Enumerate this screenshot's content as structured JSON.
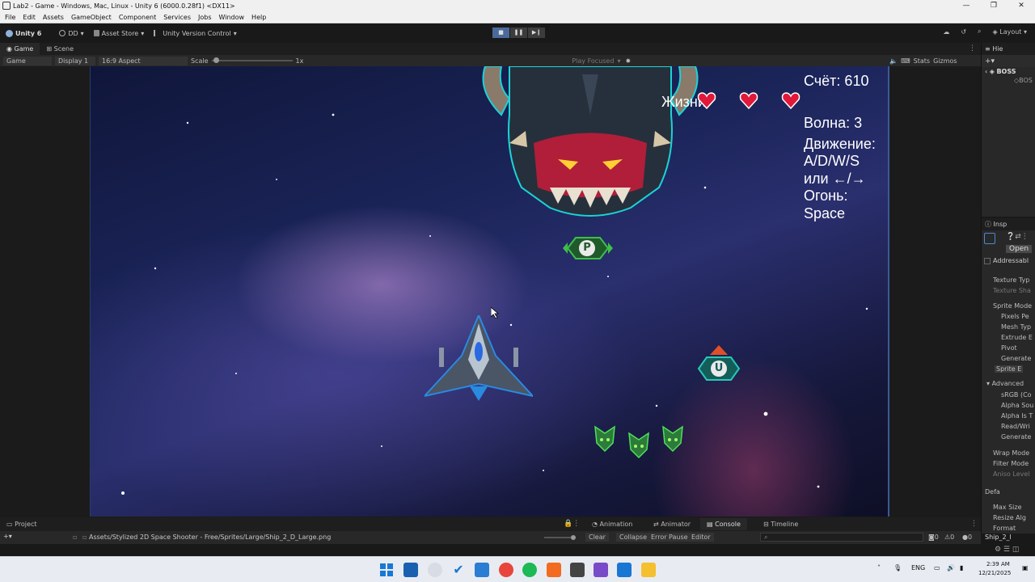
{
  "window": {
    "title": "Lab2 - Game - Windows, Mac, Linux - Unity 6 (6000.0.28f1) <DX11>",
    "controls": [
      "—",
      "❐",
      "✕"
    ]
  },
  "menu": [
    "File",
    "Edit",
    "Assets",
    "GameObject",
    "Component",
    "Services",
    "Jobs",
    "Window",
    "Help"
  ],
  "toolbar": {
    "unity_label": "Unity 6",
    "account": "DD",
    "asset_store": "Asset Store",
    "version_control": "Unity Version Control",
    "layout": "Layout"
  },
  "game_view": {
    "tabs": [
      "Game",
      "Scene"
    ],
    "mode": "Game",
    "display": "Display 1",
    "aspect": "16:9 Aspect",
    "scale_label": "Scale",
    "scale_value": "1x",
    "play_focused": "Play Focused",
    "stats": "Stats",
    "gizmos": "Gizmos"
  },
  "hud": {
    "score": "Счёт: 610",
    "lives_label": "Жизни",
    "wave": "Волна: 3",
    "controls_lines": [
      "Движение:",
      "A/D/W/S",
      "или ←/→",
      "Огонь:",
      "Space"
    ]
  },
  "powerups": {
    "p_letter": "P",
    "u_letter": "U"
  },
  "hierarchy": {
    "tab": "Hie",
    "scene": "BOSS",
    "child": "BOS"
  },
  "inspector": {
    "tab": "Insp",
    "open_button": "Open",
    "addressable": "Addressabl",
    "rows": [
      "Texture Typ",
      "Texture Sha",
      "Sprite Mode",
      "Pixels Pe",
      "Mesh Typ",
      "Extrude E",
      "Pivot",
      "Generate",
      "Sprite E",
      "Advanced",
      "sRGB (Co",
      "Alpha Sou",
      "Alpha Is T",
      "Read/Wri",
      "Generate",
      "Wrap Mode",
      "Filter Mode",
      "Aniso Level",
      "Defa",
      "Max Size",
      "Resize Alg",
      "Format"
    ],
    "footer": "Ship_2_l"
  },
  "bottom": {
    "project_tab": "Project",
    "asset_path": "Assets/Stylized 2D Space Shooter - Free/Sprites/Large/Ship_2_D_Large.png",
    "tabs": [
      "Animation",
      "Animator",
      "Console",
      "Timeline"
    ],
    "console_buttons": [
      "Clear",
      "Collapse",
      "Error Pause",
      "Editor"
    ],
    "counts": [
      "0",
      "0",
      "0"
    ]
  },
  "taskbar": {
    "lang": "ENG",
    "time": "2:39 AM",
    "date": "12/21/2025"
  },
  "colors": {
    "accent": "#4a6a9a",
    "heart": "#e0183a",
    "powerup_green": "#2f8f3a",
    "powerup_teal": "#1a8f86"
  }
}
